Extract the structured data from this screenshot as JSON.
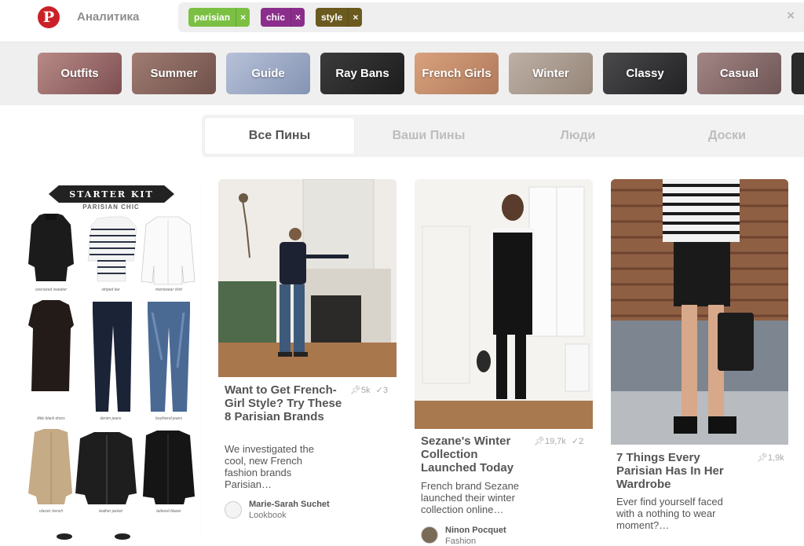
{
  "header": {
    "logo_letter": "P",
    "title": "Аналитика",
    "tags": [
      {
        "label": "parisian",
        "color": "#7bc043"
      },
      {
        "label": "chic",
        "color": "#8b2e8b"
      },
      {
        "label": "style",
        "color": "#6b5a1e"
      }
    ],
    "tag_remove_glyph": "×",
    "clear_glyph": "×"
  },
  "guides": [
    {
      "label": "Outfits",
      "color": "#9b6a6a"
    },
    {
      "label": "Summer",
      "color": "#8a6b63"
    },
    {
      "label": "Guide",
      "color": "#9aa7c4"
    },
    {
      "label": "Ray Bans",
      "color": "#2a2a2a"
    },
    {
      "label": "French Girls",
      "color": "#c68c6a"
    },
    {
      "label": "Winter",
      "color": "#a8988d"
    },
    {
      "label": "Classy",
      "color": "#3a3a3c"
    },
    {
      "label": "Casual",
      "color": "#8a6f6f"
    }
  ],
  "tabs": [
    {
      "label": "Все Пины",
      "active": true
    },
    {
      "label": "Ваши Пины",
      "active": false
    },
    {
      "label": "Люди",
      "active": false
    },
    {
      "label": "Доски",
      "active": false
    }
  ],
  "starter_kit": {
    "banner": "STARTER KIT",
    "subtitle": "PARISIAN CHIC",
    "labels": [
      "oversized sweater",
      "striped tee",
      "menswear shirt",
      "little black dress",
      "denim jeans",
      "boyfriend jeans",
      "classic trench",
      "leather jacket",
      "tailored blazer"
    ]
  },
  "pins": [
    {
      "title": "Want to Get French-Girl Style? Try These 8 Parisian Brands",
      "repins": "5k",
      "likes": "3",
      "description": "We investigated the cool, new French fashion brands Parisian…",
      "author": "Marie-Sarah Suchet",
      "board": "Lookbook"
    },
    {
      "title": "Sezane's Winter Collection Launched Today",
      "repins": "19,7k",
      "likes": "2",
      "description": "French brand Sezane launched their winter collection online…",
      "author": "Ninon Pocquet",
      "board": "Fashion"
    },
    {
      "title": "7 Things Every Parisian Has In Her Wardrobe",
      "repins": "1,9k",
      "likes": "",
      "description": "Ever find yourself faced with a nothing to wear moment?…",
      "author": "",
      "board": ""
    }
  ],
  "icons": {
    "pin": "pin-icon",
    "check": "check-icon"
  }
}
